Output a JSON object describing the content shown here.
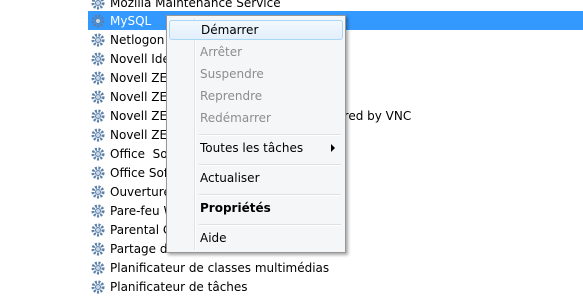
{
  "services": [
    {
      "label": "Mozilla Maintenance Service",
      "icon": "gear-icon",
      "selected": false
    },
    {
      "label": "MySQL",
      "icon": "gear-icon",
      "selected": true
    },
    {
      "label": "Netlogon",
      "icon": "gear-icon",
      "selected": false
    },
    {
      "label": "Novell Ider",
      "icon": "gear-icon",
      "selected": false
    },
    {
      "label": "Novell ZEN",
      "icon": "gear-icon",
      "selected": false
    },
    {
      "label": "Novell ZEN",
      "icon": "gear-icon",
      "selected": false
    },
    {
      "label": "Novell ZEN                                          ered by VNC",
      "icon": "gear-icon",
      "selected": false
    },
    {
      "label": "Novell ZEN",
      "icon": "gear-icon",
      "selected": false
    },
    {
      "label": "Office  Sou",
      "icon": "gear-icon",
      "selected": false
    },
    {
      "label": "Office Soft",
      "icon": "gear-icon",
      "selected": false
    },
    {
      "label": "Ouverture",
      "icon": "gear-icon",
      "selected": false
    },
    {
      "label": "Pare-feu W",
      "icon": "gear-icon",
      "selected": false
    },
    {
      "label": "Parental Co",
      "icon": "gear-icon",
      "selected": false
    },
    {
      "label": "Partage de",
      "icon": "gear-icon",
      "selected": false
    },
    {
      "label": "Planificateur de classes multimédias",
      "icon": "gear-icon",
      "selected": false
    },
    {
      "label": "Planificateur de tâches",
      "icon": "gear-icon",
      "selected": false
    }
  ],
  "context_menu": {
    "items": [
      {
        "label": "Démarrer",
        "enabled": true,
        "highlighted": true
      },
      {
        "label": "Arrêter",
        "enabled": false
      },
      {
        "label": "Suspendre",
        "enabled": false
      },
      {
        "label": "Reprendre",
        "enabled": false
      },
      {
        "label": "Redémarrer",
        "enabled": false
      },
      {
        "label": "Toutes les tâches",
        "enabled": true,
        "submenu": true
      },
      {
        "label": "Actualiser",
        "enabled": true
      },
      {
        "label": "Propriétés",
        "enabled": true,
        "bold": true
      },
      {
        "label": "Aide",
        "enabled": true
      }
    ]
  },
  "colors": {
    "selection": "#3399ff",
    "menu_background": "#f5f6f7",
    "disabled_text": "#8d8d8d"
  }
}
